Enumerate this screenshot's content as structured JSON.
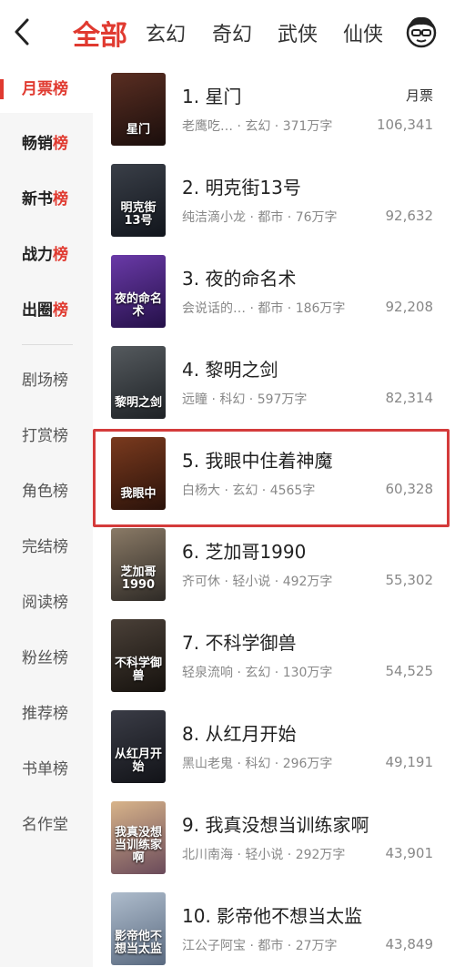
{
  "tabs": [
    "全部",
    "玄幻",
    "奇幻",
    "武侠",
    "仙侠"
  ],
  "sidebar": {
    "items": [
      {
        "text": "月票",
        "suffix": "榜"
      },
      {
        "text": "畅销",
        "suffix": "榜"
      },
      {
        "text": "新书",
        "suffix": "榜"
      },
      {
        "text": "战力",
        "suffix": "榜"
      },
      {
        "text": "出圈",
        "suffix": "榜"
      },
      {
        "text": "剧场",
        "suffix": "榜"
      },
      {
        "text": "打赏",
        "suffix": "榜"
      },
      {
        "text": "角色",
        "suffix": "榜"
      },
      {
        "text": "完结",
        "suffix": "榜"
      },
      {
        "text": "阅读",
        "suffix": "榜"
      },
      {
        "text": "粉丝",
        "suffix": "榜"
      },
      {
        "text": "推荐",
        "suffix": "榜"
      },
      {
        "text": "书单",
        "suffix": "榜"
      },
      {
        "text": "名作",
        "suffix": "堂"
      }
    ]
  },
  "list": {
    "votes_label": "月票",
    "books": [
      {
        "title": "1. 星门",
        "meta": "老鹰吃…  · 玄幻 · 371万字",
        "votes": "106,341",
        "cover_text": "星门",
        "colors": [
          "#5a2e22",
          "#1a0e0c"
        ]
      },
      {
        "title": "2. 明克街13号",
        "meta": "纯洁滴小龙 · 都市 · 76万字",
        "votes": "92,632",
        "cover_text": "明克街13号",
        "colors": [
          "#3a3f48",
          "#11151c"
        ]
      },
      {
        "title": "3. 夜的命名术",
        "meta": "会说话的…  · 都市 · 186万字",
        "votes": "92,208",
        "cover_text": "夜的命名术",
        "colors": [
          "#6a3aa8",
          "#241048"
        ]
      },
      {
        "title": "4. 黎明之剑",
        "meta": "远瞳 · 科幻 · 597万字",
        "votes": "82,314",
        "cover_text": "黎明之剑",
        "colors": [
          "#555a5e",
          "#1e2226"
        ]
      },
      {
        "title": "5. 我眼中住着神魔",
        "meta": "白杨大 · 玄幻 · 4565字",
        "votes": "60,328",
        "cover_text": "我眼中",
        "colors": [
          "#7a3a1e",
          "#2a120a"
        ]
      },
      {
        "title": "6. 芝加哥1990",
        "meta": "齐可休 · 轻小说 · 492万字",
        "votes": "55,302",
        "cover_text": "芝加哥1990",
        "colors": [
          "#8a7a66",
          "#2e2a26"
        ]
      },
      {
        "title": "7. 不科学御兽",
        "meta": "轻泉流响 · 玄幻 · 130万字",
        "votes": "54,525",
        "cover_text": "不科学御兽",
        "colors": [
          "#4a4038",
          "#16120e"
        ]
      },
      {
        "title": "8. 从红月开始",
        "meta": "黑山老鬼 · 科幻 · 296万字",
        "votes": "49,191",
        "cover_text": "从红月开始",
        "colors": [
          "#3a3c46",
          "#121318"
        ]
      },
      {
        "title": "9. 我真没想当训练家啊",
        "meta": "北川南海 · 轻小说 · 292万字",
        "votes": "43,901",
        "cover_text": "我真没想当训练家啊",
        "colors": [
          "#d8b48a",
          "#6a4a5a"
        ]
      },
      {
        "title": "10. 影帝他不想当太监",
        "meta": "江公子阿宝 · 都市 · 27万字",
        "votes": "43,849",
        "cover_text": "影帝他不想当太监",
        "colors": [
          "#aebccc",
          "#5a6a80"
        ]
      }
    ]
  }
}
